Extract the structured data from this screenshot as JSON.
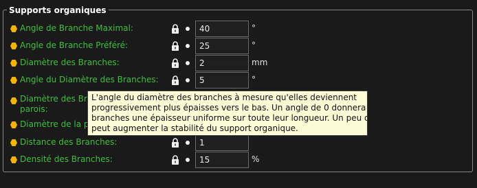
{
  "group": {
    "title": "Supports organiques"
  },
  "rows": [
    {
      "label": "Angle de Branche Maximal:",
      "value": "40",
      "unit": "°"
    },
    {
      "label": "Angle de Branche Préféré:",
      "value": "25",
      "unit": "°"
    },
    {
      "label": "Diamètre des Branches:",
      "value": "2",
      "unit": "mm"
    },
    {
      "label": "Angle du Diamètre des Branches:",
      "value": "5",
      "unit": "°"
    },
    {
      "label_line1": "Diamètre des Branc",
      "label_line2": "parois:"
    },
    {
      "label": "Diamètre de la poin"
    },
    {
      "label": "Distance des Branches:",
      "value": "1",
      "unit": ""
    },
    {
      "label": "Densité des Branches:",
      "value": "15",
      "unit": "%"
    }
  ],
  "tooltip": {
    "text": "L'angle du diamètre des branches à mesure qu'elles deviennent\nprogressivement plus épaisses vers le bas. Un angle de 0 donnera aux\nbranches une épaisseur uniforme sur toute leur longueur. Un peu d'angle\npeut augmenter la stabilité du support organique."
  },
  "colors": {
    "background": "#1a1a1a",
    "label": "#3fbf3f",
    "bullet": "#f5b400",
    "tooltip_bg": "#fbfbd8"
  },
  "icons": {
    "bullet": "hexagon-icon",
    "lock": "lock-icon",
    "dot": "dot-icon"
  }
}
